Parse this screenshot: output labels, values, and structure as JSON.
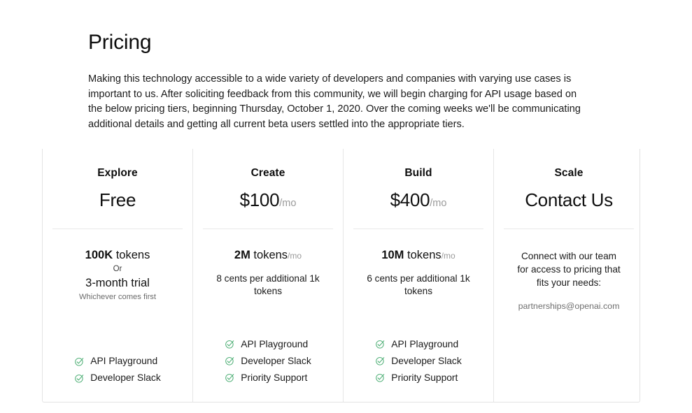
{
  "header": {
    "title": "Pricing",
    "paragraph": "Making this technology accessible to a wide variety of developers and companies with varying use cases is important to us. After soliciting feedback from this community, we will begin charging for API usage based on the below pricing tiers, beginning Thursday, October 1, 2020. Over the coming weeks we'll be communicating additional details and getting all current beta users settled into the appropriate tiers."
  },
  "colors": {
    "gradient_start": "#3a8dc8",
    "gradient_mid": "#5b43cf",
    "gradient_end": "#c81ae0",
    "check_green": "#3fa86a",
    "card_border": "#e3e3e3",
    "divider": "#e8e8e8",
    "muted_text": "#9a9a9a"
  },
  "icons": {
    "check": "check-circle-icon"
  },
  "tiers": [
    {
      "name": "Explore",
      "price": "Free",
      "price_suffix": "",
      "tokens_amount": "100K",
      "tokens_label": "tokens",
      "tokens_suffix": "",
      "or_label": "Or",
      "trial": "3-month trial",
      "note": "Whichever comes first",
      "overage": "",
      "contact_text": "",
      "contact_email": "",
      "features": [
        "API Playground",
        "Developer Slack"
      ]
    },
    {
      "name": "Create",
      "price": "$100",
      "price_suffix": "/mo",
      "tokens_amount": "2M",
      "tokens_label": "tokens",
      "tokens_suffix": "/mo",
      "or_label": "",
      "trial": "",
      "note": "",
      "overage": "8 cents per additional 1k tokens",
      "contact_text": "",
      "contact_email": "",
      "features": [
        "API Playground",
        "Developer Slack",
        "Priority Support"
      ]
    },
    {
      "name": "Build",
      "price": "$400",
      "price_suffix": "/mo",
      "tokens_amount": "10M",
      "tokens_label": "tokens",
      "tokens_suffix": "/mo",
      "or_label": "",
      "trial": "",
      "note": "",
      "overage": "6 cents per additional 1k tokens",
      "contact_text": "",
      "contact_email": "",
      "features": [
        "API Playground",
        "Developer Slack",
        "Priority Support"
      ]
    },
    {
      "name": "Scale",
      "price": "Contact Us",
      "price_suffix": "",
      "tokens_amount": "",
      "tokens_label": "",
      "tokens_suffix": "",
      "or_label": "",
      "trial": "",
      "note": "",
      "overage": "",
      "contact_text": "Connect with our team for access to pricing that fits your needs:",
      "contact_email": "partnerships@openai.com",
      "features": []
    }
  ]
}
